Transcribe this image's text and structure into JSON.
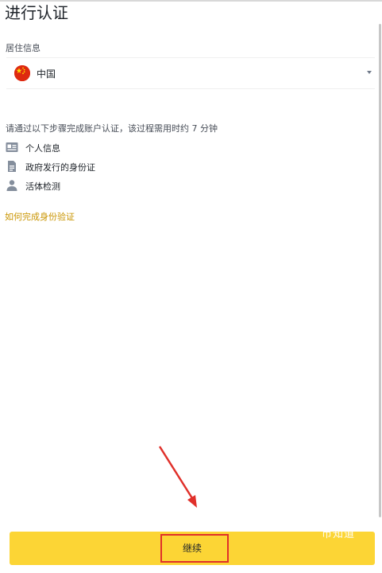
{
  "page": {
    "title": "进行认证"
  },
  "residence": {
    "label": "居住信息",
    "selected_country": "中国",
    "flag_icon": "china-flag-icon"
  },
  "verification": {
    "intro": "请通过以下步骤完成账户认证，该过程需用时约 7 分钟",
    "steps": [
      {
        "label": "个人信息",
        "icon": "id-card-icon"
      },
      {
        "label": "政府发行的身份证",
        "icon": "document-icon"
      },
      {
        "label": "活体检测",
        "icon": "person-icon"
      }
    ],
    "help_link": "如何完成身份验证"
  },
  "footer": {
    "continue_label": "继续"
  },
  "overlay": {
    "watermark": "币知道"
  },
  "colors": {
    "accent": "#fcd535",
    "link": "#c99400",
    "annotation": "#e0302a"
  }
}
